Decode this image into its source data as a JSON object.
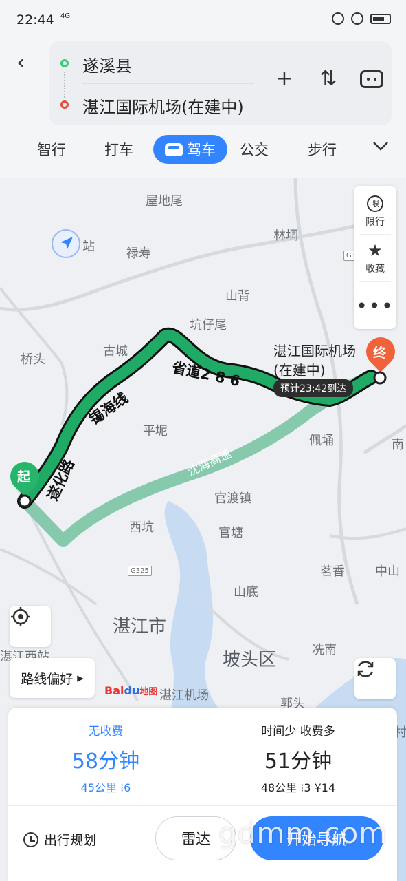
{
  "status": {
    "time": "22:44",
    "network": "4G"
  },
  "route": {
    "from": "遂溪县",
    "to": "湛江国际机场(在建中)"
  },
  "modes": [
    "智行",
    "打车",
    "驾车",
    "公交",
    "步行"
  ],
  "map": {
    "places": {
      "wudiwei": "屋地尾",
      "zhan": "站",
      "lushou": "禄寿",
      "linhe": "林垌",
      "shanbei": "山背",
      "kengziwei": "坑仔尾",
      "guchang": "古城",
      "qiaotou": "桥头",
      "pingnu": "平坭",
      "peiyong": "佩埇",
      "nan": "南",
      "guanduzhen": "官渡镇",
      "xikeng": "西坑",
      "guantang": "官塘",
      "mingxiang": "茗香",
      "zhongshan": "中山",
      "shandi": "山底",
      "zhanjiang": "湛江市",
      "xiannan": "冼南",
      "potou": "坡头区",
      "zhanjiang_west": "湛江西站",
      "zhanjiang_airport": "湛江机场",
      "guotou": "郭头",
      "cun": "村"
    },
    "roads": {
      "suihua": "遂化路",
      "xihai": "锡海线",
      "shengdao": "省道2 8 6",
      "shenhai": "沈海高速"
    },
    "shields": {
      "g325": "G325",
      "g3": "G3"
    },
    "airport_label_line1": "湛江国际机场",
    "airport_label_line2": "(在建中)",
    "eta": "预计23:42到达",
    "start": "起",
    "end": "终",
    "route_pref": "路线偏好",
    "logo_bai": "Bai",
    "logo_du": "du",
    "logo_map": "地图"
  },
  "side_tools": {
    "limit_icon": "限",
    "limit": "限行",
    "favorite": "收藏",
    "more": "•••"
  },
  "options": [
    {
      "tag": "无收费",
      "duration": "58分钟",
      "meta": "45公里  ⁝6"
    },
    {
      "tag": "时间少  收费多",
      "duration": "51分钟",
      "meta": "48公里  ⁝3  ¥14"
    }
  ],
  "actions": {
    "plan": "出行规划",
    "radar": "雷达",
    "start_nav": "开始导航"
  },
  "watermark": "gdmm.com"
}
